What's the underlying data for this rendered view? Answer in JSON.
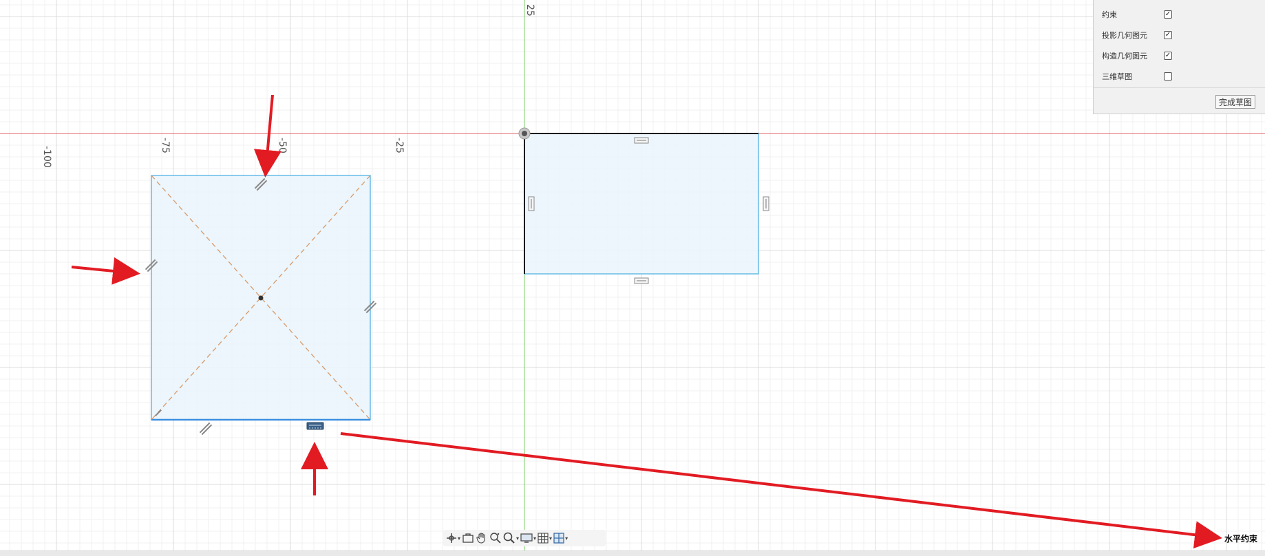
{
  "axis": {
    "ticks": [
      {
        "label": "-100",
        "value": -100
      },
      {
        "label": "-75",
        "value": -75
      },
      {
        "label": "-50",
        "value": -50
      },
      {
        "label": "-25",
        "value": -25
      },
      {
        "label": "25",
        "value": 25
      }
    ]
  },
  "sketch_palette": {
    "rows": [
      {
        "label": "约束",
        "checked": true
      },
      {
        "label": "投影几何图元",
        "checked": true
      },
      {
        "label": "构造几何图元",
        "checked": true
      },
      {
        "label": "三维草图",
        "checked": false
      }
    ],
    "finish_button": "完成草图"
  },
  "annotation": {
    "text": "水平约束"
  },
  "colors": {
    "x_axis": "#e06060",
    "y_axis": "#7ccf6a",
    "profile_fill": "#e6f3fb",
    "profile_edge": "#66bce6",
    "construction": "#d99a6a",
    "arrow": "#e21b23"
  },
  "toolbar": {
    "icons": [
      "orbit-icon",
      "look-at-icon",
      "pan-icon",
      "zoom-icon",
      "fit-icon",
      "display-settings-icon",
      "grid-settings-icon",
      "viewports-icon"
    ]
  }
}
